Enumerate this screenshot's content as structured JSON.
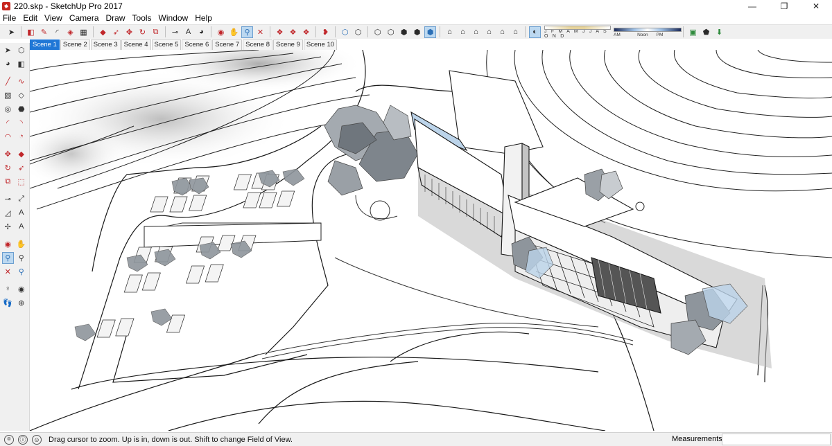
{
  "window": {
    "title": "220.skp - SketchUp Pro 2017",
    "minimize": "—",
    "maximize": "❐",
    "close": "✕"
  },
  "menu": [
    "File",
    "Edit",
    "View",
    "Camera",
    "Draw",
    "Tools",
    "Window",
    "Help"
  ],
  "toolbar": {
    "months_label": "J F M A M J J A S O N D",
    "time_start": "05:11 AM",
    "time_mid": "Noon",
    "time_end": "07:11 PM"
  },
  "scenes": [
    "Scene 1",
    "Scene 2",
    "Scene 3",
    "Scene 4",
    "Scene 5",
    "Scene 6",
    "Scene 7",
    "Scene 8",
    "Scene 9",
    "Scene 10"
  ],
  "active_scene": "Scene 1",
  "status": {
    "hint": "Drag cursor to zoom.  Up is in, down is out. Shift to change Field of View.",
    "measurements_label": "Measurements",
    "measurements_value": ""
  },
  "colors": {
    "accent": "#1f77d6",
    "glass": "#bcd4ea",
    "shadow": "#b9b9b9",
    "tree": "#8e959c"
  }
}
